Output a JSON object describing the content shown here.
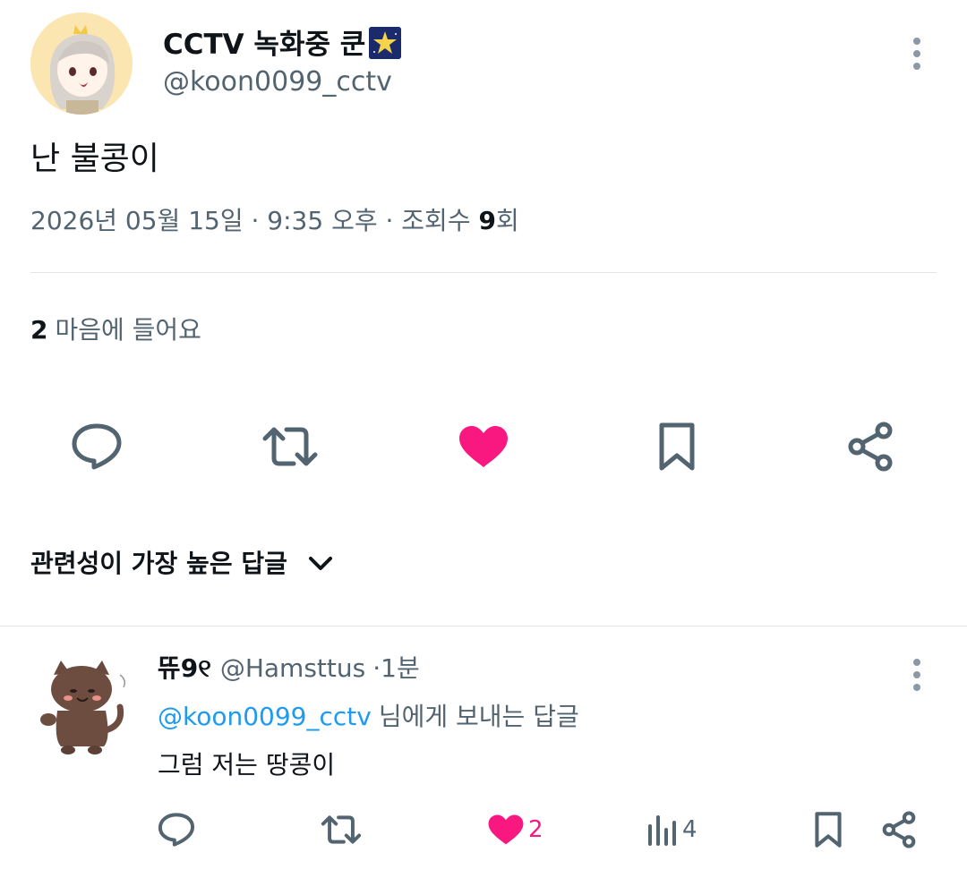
{
  "tweet": {
    "author_name": "CCTV 녹화중 쿤",
    "author_handle": "@koon0099_cctv",
    "text": "난 불콩이",
    "date": "2026년 05월 15일 · 9:35 오후 · 조회수 ",
    "views": "9",
    "views_suffix": "회",
    "likes_count": "2",
    "likes_label": "마음에 들어요",
    "liked": true
  },
  "sort": {
    "label": "관련성이 가장 높은 답글"
  },
  "reply": {
    "author_name": "뜌9୧",
    "author_handle": "@Hamsttus",
    "separator": "·",
    "time": "1분",
    "mention": "@koon0099_cctv",
    "to_text": "님에게 보내는 답글",
    "text": "그럼 저는 땅콩이",
    "likes": "2",
    "views": "4",
    "liked": true
  },
  "colors": {
    "like_pink": "#f91880",
    "icon_gray": "#536471",
    "link_blue": "#1d9bf0",
    "text_dark": "#0f1419"
  },
  "icons": [
    "more-vert-icon",
    "reply-icon",
    "retweet-icon",
    "heart-icon",
    "bookmark-icon",
    "share-icon",
    "chevron-down-icon",
    "analytics-icon"
  ]
}
